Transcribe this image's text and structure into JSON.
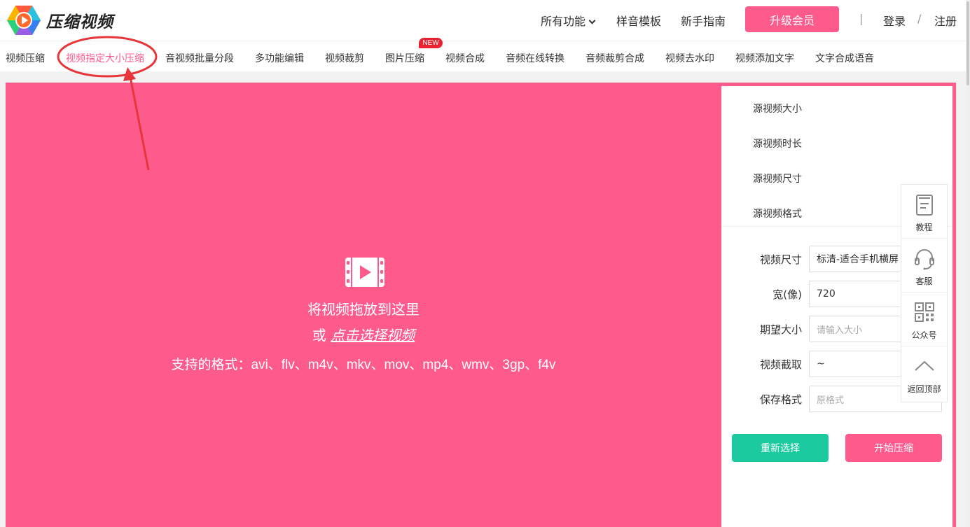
{
  "brand": {
    "name": "压缩视频"
  },
  "header": {
    "nav": [
      "所有功能",
      "样音模板",
      "新手指南"
    ],
    "upgrade_label": "升级会员",
    "separator": "|",
    "login": "登录",
    "slash": "/",
    "register": "注册"
  },
  "tabs": [
    {
      "label": "视频压缩"
    },
    {
      "label": "视频指定大小压缩",
      "active": true
    },
    {
      "label": "音视频批量分段"
    },
    {
      "label": "多功能编辑"
    },
    {
      "label": "视频裁剪"
    },
    {
      "label": "图片压缩",
      "badge": "NEW"
    },
    {
      "label": "视频合成"
    },
    {
      "label": "音频在线转换"
    },
    {
      "label": "音频裁剪合成"
    },
    {
      "label": "视频去水印"
    },
    {
      "label": "视频添加文字"
    },
    {
      "label": "文字合成语音"
    }
  ],
  "upload": {
    "drop_text": "将视频拖放到这里",
    "or_text": "或",
    "pick_link": "点击选择视频",
    "formats": "支持的格式：avi、flv、m4v、mkv、mov、mp4、wmv、3gp、f4v"
  },
  "panel": {
    "info": [
      "源视频大小",
      "源视频时长",
      "源视频尺寸",
      "源视频格式"
    ],
    "fields": [
      {
        "label": "视频尺寸",
        "value": "标清-适合手机横屏",
        "placeholder": ""
      },
      {
        "label": "宽(像)",
        "value": "720",
        "placeholder": ""
      },
      {
        "label": "期望大小",
        "value": "",
        "placeholder": "请输入大小"
      },
      {
        "label": "视频截取",
        "value": "~",
        "placeholder": ""
      },
      {
        "label": "保存格式",
        "value": "",
        "placeholder": "原格式"
      }
    ],
    "reselect_label": "重新选择",
    "start_label": "开始压缩"
  },
  "floatbar": {
    "items": [
      {
        "label": "教程",
        "icon": "book-icon"
      },
      {
        "label": "客服",
        "icon": "headset-icon"
      },
      {
        "label": "公众号",
        "icon": "qrcode-icon"
      },
      {
        "label": "返回顶部",
        "icon": "chevron-up-icon"
      }
    ]
  },
  "colors": {
    "accent": "#ff5a8c",
    "green": "#1ccaa0",
    "badge": "#e8232f",
    "annotation": "#e8353a"
  }
}
